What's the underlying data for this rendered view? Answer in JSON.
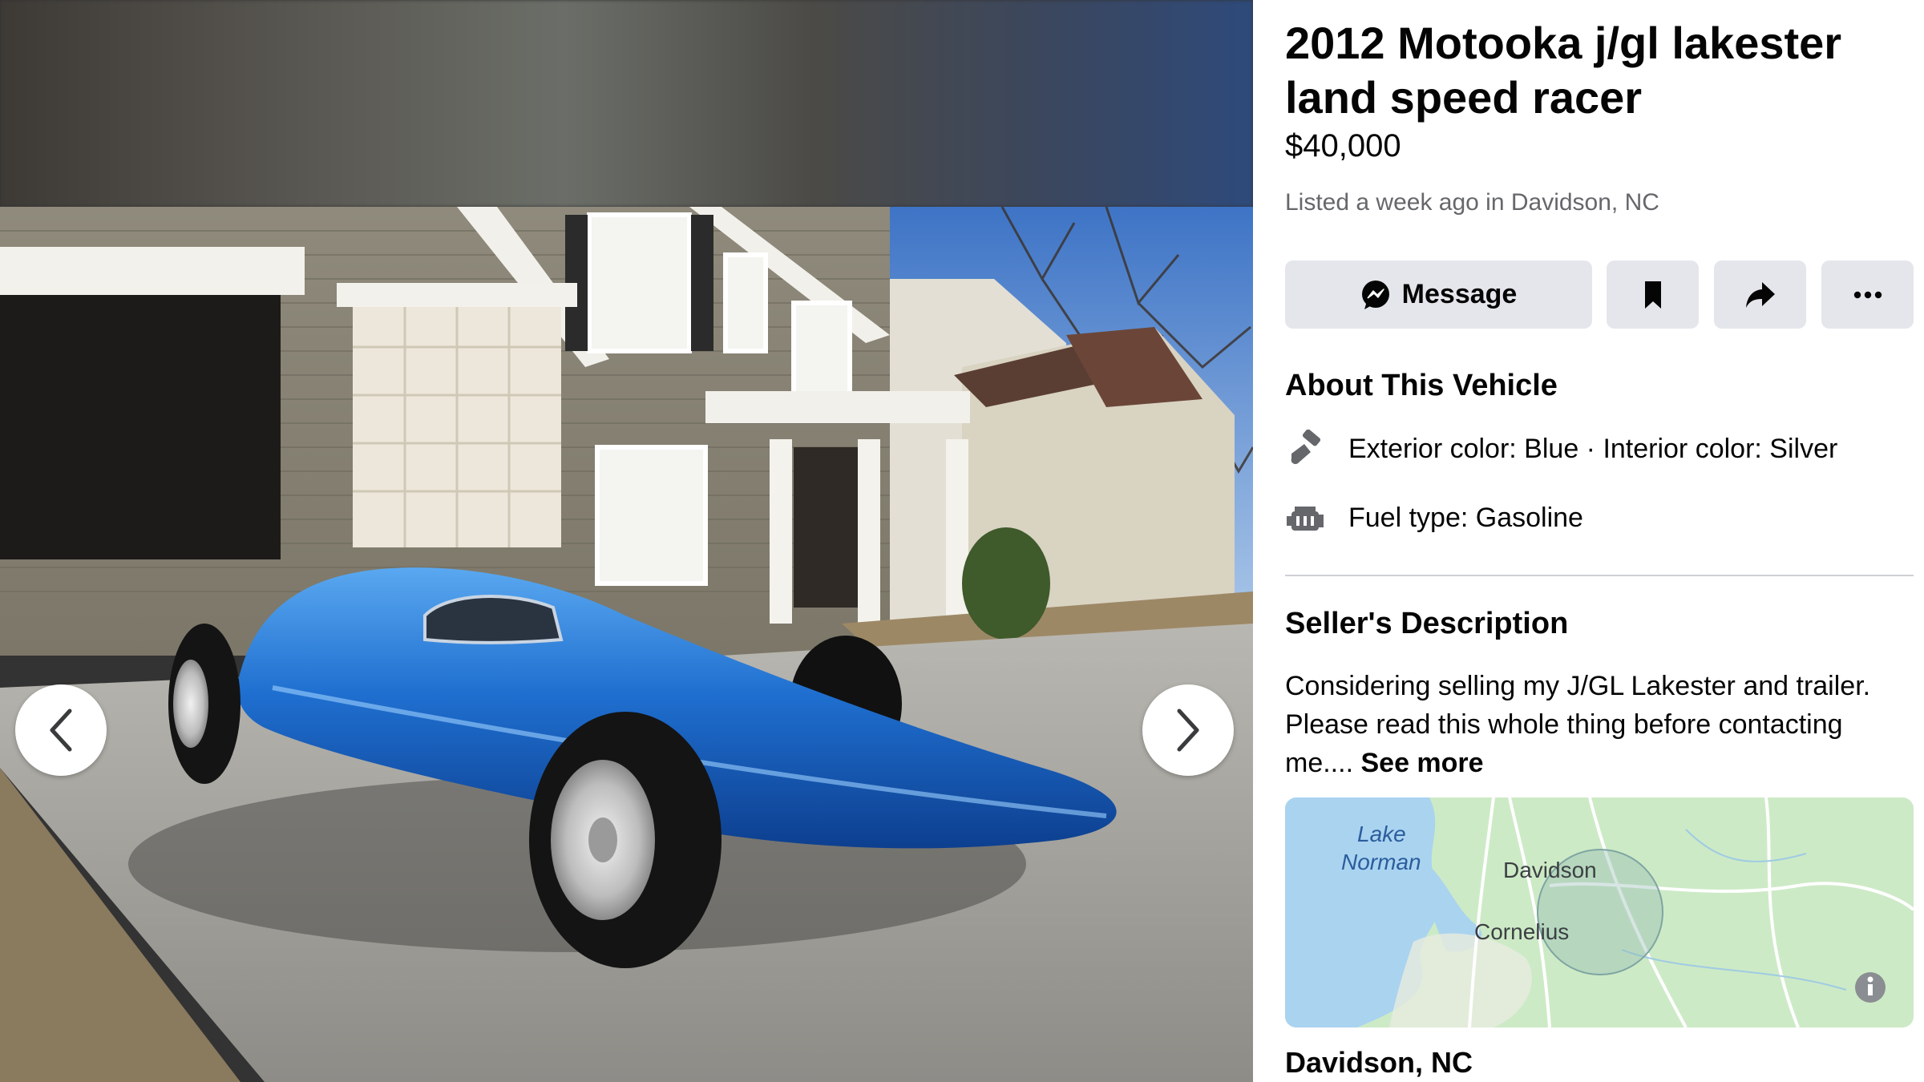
{
  "listing": {
    "title": "2012 Motooka j/gl lakester land speed racer",
    "price": "$40,000",
    "listed": "Listed a week ago in Davidson, NC"
  },
  "actions": {
    "message_label": "Message",
    "icons": [
      "messenger-icon",
      "bookmark-icon",
      "share-icon",
      "more-icon"
    ]
  },
  "about": {
    "heading": "About This Vehicle",
    "color_text": "Exterior color: Blue · Interior color: Silver",
    "fuel_text": "Fuel type: Gasoline",
    "icons": [
      "paint-brush-icon",
      "engine-icon"
    ]
  },
  "description": {
    "heading": "Seller's Description",
    "text": "Considering selling my J/GL Lakester and trailer. Please read this whole thing before contacting me....",
    "see_more": "See more"
  },
  "map": {
    "labels": {
      "lake_line1": "Lake",
      "lake_line2": "Norman",
      "town1": "Davidson",
      "town2": "Cornelius"
    }
  },
  "location": "Davidson, NC",
  "colors": {
    "button_bg": "#e4e6eb",
    "secondary_text": "#65676b",
    "primary_text": "#050505",
    "car_blue": "#1f6fd0"
  }
}
